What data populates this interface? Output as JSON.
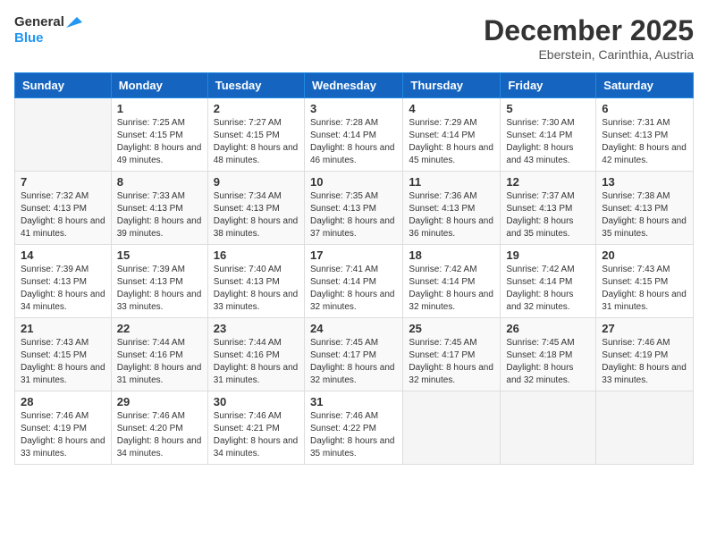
{
  "logo": {
    "general": "General",
    "blue": "Blue"
  },
  "header": {
    "month": "December 2025",
    "location": "Eberstein, Carinthia, Austria"
  },
  "weekdays": [
    "Sunday",
    "Monday",
    "Tuesday",
    "Wednesday",
    "Thursday",
    "Friday",
    "Saturday"
  ],
  "weeks": [
    [
      {
        "day": "",
        "sunrise": "",
        "sunset": "",
        "daylight": ""
      },
      {
        "day": "1",
        "sunrise": "Sunrise: 7:25 AM",
        "sunset": "Sunset: 4:15 PM",
        "daylight": "Daylight: 8 hours and 49 minutes."
      },
      {
        "day": "2",
        "sunrise": "Sunrise: 7:27 AM",
        "sunset": "Sunset: 4:15 PM",
        "daylight": "Daylight: 8 hours and 48 minutes."
      },
      {
        "day": "3",
        "sunrise": "Sunrise: 7:28 AM",
        "sunset": "Sunset: 4:14 PM",
        "daylight": "Daylight: 8 hours and 46 minutes."
      },
      {
        "day": "4",
        "sunrise": "Sunrise: 7:29 AM",
        "sunset": "Sunset: 4:14 PM",
        "daylight": "Daylight: 8 hours and 45 minutes."
      },
      {
        "day": "5",
        "sunrise": "Sunrise: 7:30 AM",
        "sunset": "Sunset: 4:14 PM",
        "daylight": "Daylight: 8 hours and 43 minutes."
      },
      {
        "day": "6",
        "sunrise": "Sunrise: 7:31 AM",
        "sunset": "Sunset: 4:13 PM",
        "daylight": "Daylight: 8 hours and 42 minutes."
      }
    ],
    [
      {
        "day": "7",
        "sunrise": "Sunrise: 7:32 AM",
        "sunset": "Sunset: 4:13 PM",
        "daylight": "Daylight: 8 hours and 41 minutes."
      },
      {
        "day": "8",
        "sunrise": "Sunrise: 7:33 AM",
        "sunset": "Sunset: 4:13 PM",
        "daylight": "Daylight: 8 hours and 39 minutes."
      },
      {
        "day": "9",
        "sunrise": "Sunrise: 7:34 AM",
        "sunset": "Sunset: 4:13 PM",
        "daylight": "Daylight: 8 hours and 38 minutes."
      },
      {
        "day": "10",
        "sunrise": "Sunrise: 7:35 AM",
        "sunset": "Sunset: 4:13 PM",
        "daylight": "Daylight: 8 hours and 37 minutes."
      },
      {
        "day": "11",
        "sunrise": "Sunrise: 7:36 AM",
        "sunset": "Sunset: 4:13 PM",
        "daylight": "Daylight: 8 hours and 36 minutes."
      },
      {
        "day": "12",
        "sunrise": "Sunrise: 7:37 AM",
        "sunset": "Sunset: 4:13 PM",
        "daylight": "Daylight: 8 hours and 35 minutes."
      },
      {
        "day": "13",
        "sunrise": "Sunrise: 7:38 AM",
        "sunset": "Sunset: 4:13 PM",
        "daylight": "Daylight: 8 hours and 35 minutes."
      }
    ],
    [
      {
        "day": "14",
        "sunrise": "Sunrise: 7:39 AM",
        "sunset": "Sunset: 4:13 PM",
        "daylight": "Daylight: 8 hours and 34 minutes."
      },
      {
        "day": "15",
        "sunrise": "Sunrise: 7:39 AM",
        "sunset": "Sunset: 4:13 PM",
        "daylight": "Daylight: 8 hours and 33 minutes."
      },
      {
        "day": "16",
        "sunrise": "Sunrise: 7:40 AM",
        "sunset": "Sunset: 4:13 PM",
        "daylight": "Daylight: 8 hours and 33 minutes."
      },
      {
        "day": "17",
        "sunrise": "Sunrise: 7:41 AM",
        "sunset": "Sunset: 4:14 PM",
        "daylight": "Daylight: 8 hours and 32 minutes."
      },
      {
        "day": "18",
        "sunrise": "Sunrise: 7:42 AM",
        "sunset": "Sunset: 4:14 PM",
        "daylight": "Daylight: 8 hours and 32 minutes."
      },
      {
        "day": "19",
        "sunrise": "Sunrise: 7:42 AM",
        "sunset": "Sunset: 4:14 PM",
        "daylight": "Daylight: 8 hours and 32 minutes."
      },
      {
        "day": "20",
        "sunrise": "Sunrise: 7:43 AM",
        "sunset": "Sunset: 4:15 PM",
        "daylight": "Daylight: 8 hours and 31 minutes."
      }
    ],
    [
      {
        "day": "21",
        "sunrise": "Sunrise: 7:43 AM",
        "sunset": "Sunset: 4:15 PM",
        "daylight": "Daylight: 8 hours and 31 minutes."
      },
      {
        "day": "22",
        "sunrise": "Sunrise: 7:44 AM",
        "sunset": "Sunset: 4:16 PM",
        "daylight": "Daylight: 8 hours and 31 minutes."
      },
      {
        "day": "23",
        "sunrise": "Sunrise: 7:44 AM",
        "sunset": "Sunset: 4:16 PM",
        "daylight": "Daylight: 8 hours and 31 minutes."
      },
      {
        "day": "24",
        "sunrise": "Sunrise: 7:45 AM",
        "sunset": "Sunset: 4:17 PM",
        "daylight": "Daylight: 8 hours and 32 minutes."
      },
      {
        "day": "25",
        "sunrise": "Sunrise: 7:45 AM",
        "sunset": "Sunset: 4:17 PM",
        "daylight": "Daylight: 8 hours and 32 minutes."
      },
      {
        "day": "26",
        "sunrise": "Sunrise: 7:45 AM",
        "sunset": "Sunset: 4:18 PM",
        "daylight": "Daylight: 8 hours and 32 minutes."
      },
      {
        "day": "27",
        "sunrise": "Sunrise: 7:46 AM",
        "sunset": "Sunset: 4:19 PM",
        "daylight": "Daylight: 8 hours and 33 minutes."
      }
    ],
    [
      {
        "day": "28",
        "sunrise": "Sunrise: 7:46 AM",
        "sunset": "Sunset: 4:19 PM",
        "daylight": "Daylight: 8 hours and 33 minutes."
      },
      {
        "day": "29",
        "sunrise": "Sunrise: 7:46 AM",
        "sunset": "Sunset: 4:20 PM",
        "daylight": "Daylight: 8 hours and 34 minutes."
      },
      {
        "day": "30",
        "sunrise": "Sunrise: 7:46 AM",
        "sunset": "Sunset: 4:21 PM",
        "daylight": "Daylight: 8 hours and 34 minutes."
      },
      {
        "day": "31",
        "sunrise": "Sunrise: 7:46 AM",
        "sunset": "Sunset: 4:22 PM",
        "daylight": "Daylight: 8 hours and 35 minutes."
      },
      {
        "day": "",
        "sunrise": "",
        "sunset": "",
        "daylight": ""
      },
      {
        "day": "",
        "sunrise": "",
        "sunset": "",
        "daylight": ""
      },
      {
        "day": "",
        "sunrise": "",
        "sunset": "",
        "daylight": ""
      }
    ]
  ]
}
